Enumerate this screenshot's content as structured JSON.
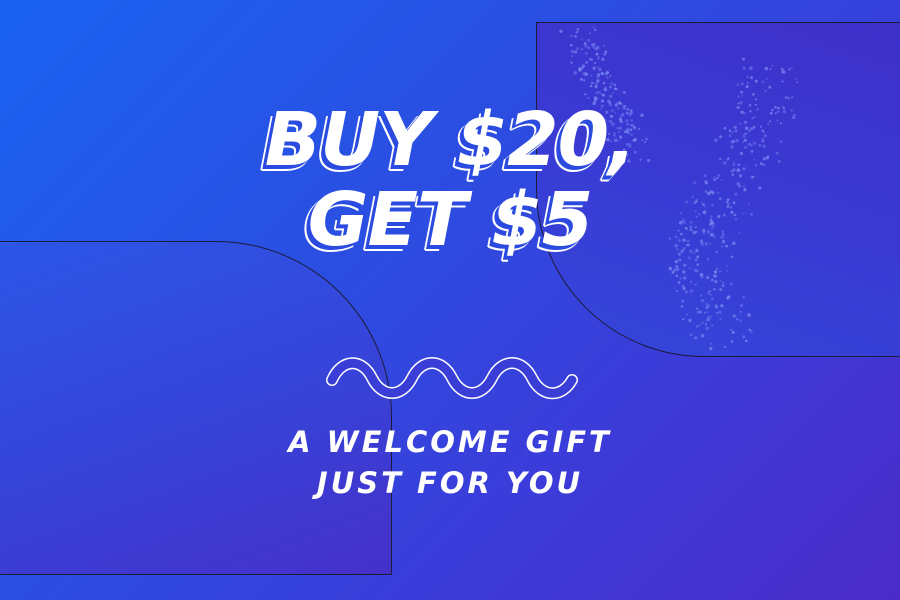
{
  "promo": {
    "headline_line1": "BUY $20,",
    "headline_line2": "GET $5",
    "subtext_line1": "A WELCOME GIFT",
    "subtext_line2": "JUST FOR YOU"
  },
  "colors": {
    "background_start": "#1a63f2",
    "background_end": "#4b2bc8",
    "text": "#ffffff",
    "panel_outline": "#1b1b3a",
    "dot_pattern": "#7d8cf5"
  },
  "decorations": {
    "divider": "wavy-line",
    "pattern": "dot-texture"
  }
}
